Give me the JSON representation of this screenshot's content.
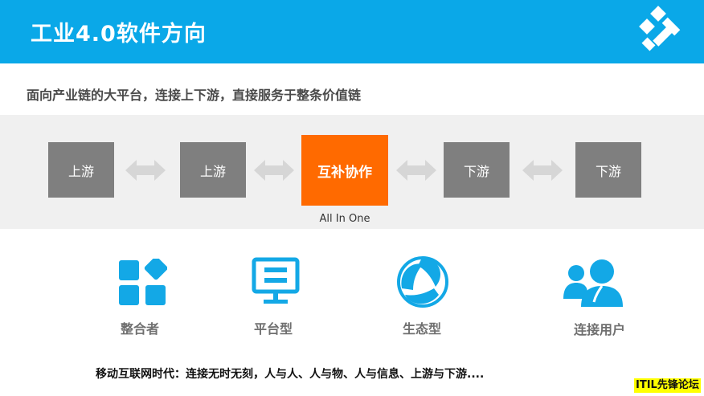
{
  "header": {
    "title": "工业4.0软件方向",
    "bg_color": "#0aa8e8"
  },
  "subtitle": "面向产业链的大平台，连接上下游，直接服务于整条价值链",
  "flow": {
    "boxes": [
      "上游",
      "上游",
      "互补协作",
      "下游",
      "下游"
    ],
    "center_caption": "All In One",
    "box_color": "#7f7f7f",
    "accent_color": "#ff6a00"
  },
  "icons": [
    {
      "label": "整合者",
      "icon": "grid-blocks-icon"
    },
    {
      "label": "平台型",
      "icon": "monitor-icon"
    },
    {
      "label": "生态型",
      "icon": "ecology-leaves-icon"
    },
    {
      "label": "连接用户",
      "icon": "users-icon"
    }
  ],
  "footer": "移动互联网时代：连接无时无刻，人与人、人与物、人与信息、上游与下游....",
  "watermark": "ITIL先锋论坛"
}
